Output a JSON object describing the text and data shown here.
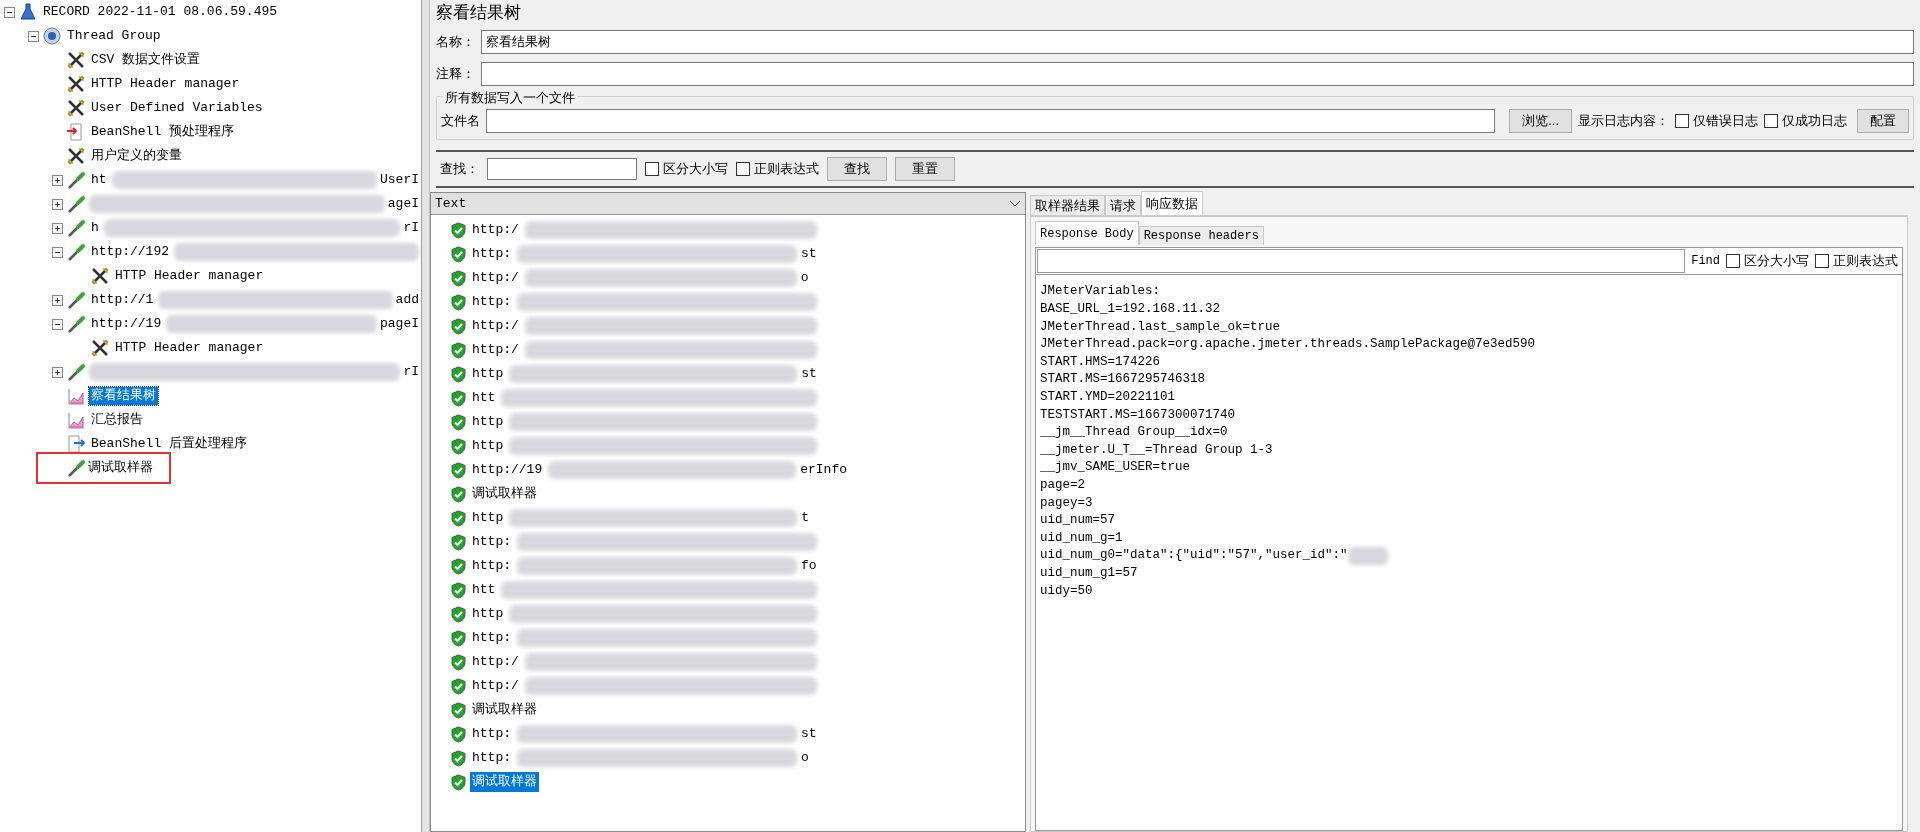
{
  "tree": [
    {
      "kind": "test_plan",
      "label": "RECORD 2022-11-01 08.06.59.495",
      "expanded": true,
      "children": [
        {
          "kind": "thread_group",
          "label": "Thread Group",
          "expanded": true,
          "children": [
            {
              "kind": "config",
              "label": "CSV 数据文件设置"
            },
            {
              "kind": "config",
              "label": "HTTP Header manager"
            },
            {
              "kind": "config",
              "label": "User Defined Variables"
            },
            {
              "kind": "preprocessor",
              "label": "BeanShell 预处理程序"
            },
            {
              "kind": "config",
              "label": "用户定义的变量"
            },
            {
              "kind": "sampler",
              "label": "ht",
              "tail": "UserI",
              "redacted": true,
              "expanded": false
            },
            {
              "kind": "sampler",
              "tail": "ageI",
              "redacted": true,
              "expanded": false
            },
            {
              "kind": "sampler",
              "label": "h",
              "tail": "rI",
              "redacted": true,
              "expanded": false
            },
            {
              "kind": "sampler",
              "label": "http://192",
              "redacted": true,
              "expanded": true,
              "children": [
                {
                  "kind": "config",
                  "label": "HTTP Header manager"
                }
              ]
            },
            {
              "kind": "sampler",
              "label": "http://1",
              "tail": "add",
              "redacted": true,
              "expanded": false
            },
            {
              "kind": "sampler",
              "label": "http://19",
              "tail": "pageI",
              "redacted": true,
              "expanded": true,
              "children": [
                {
                  "kind": "config",
                  "label": "HTTP Header manager"
                }
              ]
            },
            {
              "kind": "sampler",
              "tail": "rI",
              "redacted": true,
              "expanded": false
            },
            {
              "kind": "listener",
              "label": "察看结果树",
              "selected": true
            },
            {
              "kind": "listener",
              "label": "汇总报告",
              "selected": false
            },
            {
              "kind": "postprocessor",
              "label": "BeanShell 后置处理程序"
            },
            {
              "kind": "sampler",
              "label": "调试取样器",
              "annotated": true
            }
          ]
        }
      ]
    }
  ],
  "panel": {
    "title": "察看结果树",
    "name_label": "名称：",
    "name_value": "察看结果树",
    "comment_label": "注释：",
    "file_group": {
      "title": "所有数据写入一个文件",
      "label": "文件名",
      "browse": "浏览...",
      "log_label": "显示日志内容：",
      "checkboxes": [
        {
          "label": "仅错误日志",
          "checked": false
        },
        {
          "label": "仅成功日志",
          "checked": false
        }
      ],
      "configure": "配置"
    },
    "search": {
      "label": "查找：",
      "checkboxes": [
        {
          "label": "区分大小写",
          "checked": false
        },
        {
          "label": "正则表达式",
          "checked": false
        }
      ],
      "buttons": [
        "查找",
        "重置"
      ]
    }
  },
  "results": {
    "renderer": "Text",
    "items": [
      {
        "label": "http:/",
        "redacted": true,
        "selected": false
      },
      {
        "label": "http:",
        "tail": "st",
        "redacted": true,
        "selected": false
      },
      {
        "label": "http:/",
        "tail": "o",
        "redacted": true,
        "selected": false
      },
      {
        "label": "http:",
        "redacted": true,
        "selected": false
      },
      {
        "label": "http:/",
        "redacted": true,
        "selected": false
      },
      {
        "label": "http:/",
        "redacted": true,
        "selected": false
      },
      {
        "label": "http",
        "tail": "st",
        "redacted": true,
        "selected": false
      },
      {
        "label": "htt",
        "redacted": true,
        "selected": false
      },
      {
        "label": "http",
        "redacted": true,
        "selected": false
      },
      {
        "label": "http",
        "redacted": true,
        "selected": false
      },
      {
        "label": "http://19",
        "tail": "erInfo",
        "redacted": true,
        "selected": false
      },
      {
        "label": "调试取样器",
        "selected": false
      },
      {
        "label": "http",
        "tail": "t",
        "redacted": true,
        "selected": false
      },
      {
        "label": "http:",
        "redacted": true,
        "selected": false
      },
      {
        "label": "http:",
        "tail": "fo",
        "redacted": true,
        "selected": false
      },
      {
        "label": "htt",
        "redacted": true,
        "selected": false
      },
      {
        "label": "http",
        "redacted": true,
        "selected": false
      },
      {
        "label": "http:",
        "redacted": true,
        "selected": false
      },
      {
        "label": "http:/",
        "redacted": true,
        "selected": false
      },
      {
        "label": "http:/",
        "redacted": true,
        "selected": false
      },
      {
        "label": "调试取样器",
        "selected": false
      },
      {
        "label": "http:",
        "tail": "st",
        "redacted": true,
        "selected": false
      },
      {
        "label": "http:",
        "tail": "o",
        "redacted": true,
        "selected": false
      },
      {
        "label": "调试取样器",
        "selected": true
      }
    ]
  },
  "detail": {
    "tabs": [
      {
        "label": "取样器结果",
        "selected": false
      },
      {
        "label": "请求",
        "selected": false
      },
      {
        "label": "响应数据",
        "selected": true
      }
    ],
    "subtabs": [
      {
        "label": "Response Body",
        "selected": true
      },
      {
        "label": "Response headers",
        "selected": false
      }
    ],
    "find_label": "Find",
    "checkboxes": [
      {
        "label": "区分大小写",
        "checked": false
      },
      {
        "label": "正则表达式",
        "checked": false
      }
    ],
    "lines": [
      {
        "text": "JMeterVariables:"
      },
      {
        "text": "BASE_URL_1=192.168.11.32"
      },
      {
        "text": "JMeterThread.last_sample_ok=true"
      },
      {
        "text": "JMeterThread.pack=org.apache.jmeter.threads.SamplePackage@7e3ed590"
      },
      {
        "text": "START.HMS=174226"
      },
      {
        "text": "START.MS=1667295746318"
      },
      {
        "text": "START.YMD=20221101"
      },
      {
        "text": "TESTSTART.MS=1667300071740"
      },
      {
        "text": "__jm__Thread Group__idx=0"
      },
      {
        "text": "__jmeter.U_T__=Thread Group 1-3"
      },
      {
        "text": "__jmv_SAME_USER=true"
      },
      {
        "text": "page=2"
      },
      {
        "text": "pagey=3"
      },
      {
        "text": "uid_num=57"
      },
      {
        "text": "uid_num_g=1"
      },
      {
        "text": "uid_num_g0=\"data\":{\"uid\":\"57\",\"user_id\":\"",
        "redacted": true
      },
      {
        "text": "uid_num_g1=57"
      },
      {
        "text": "uidy=50"
      }
    ]
  }
}
